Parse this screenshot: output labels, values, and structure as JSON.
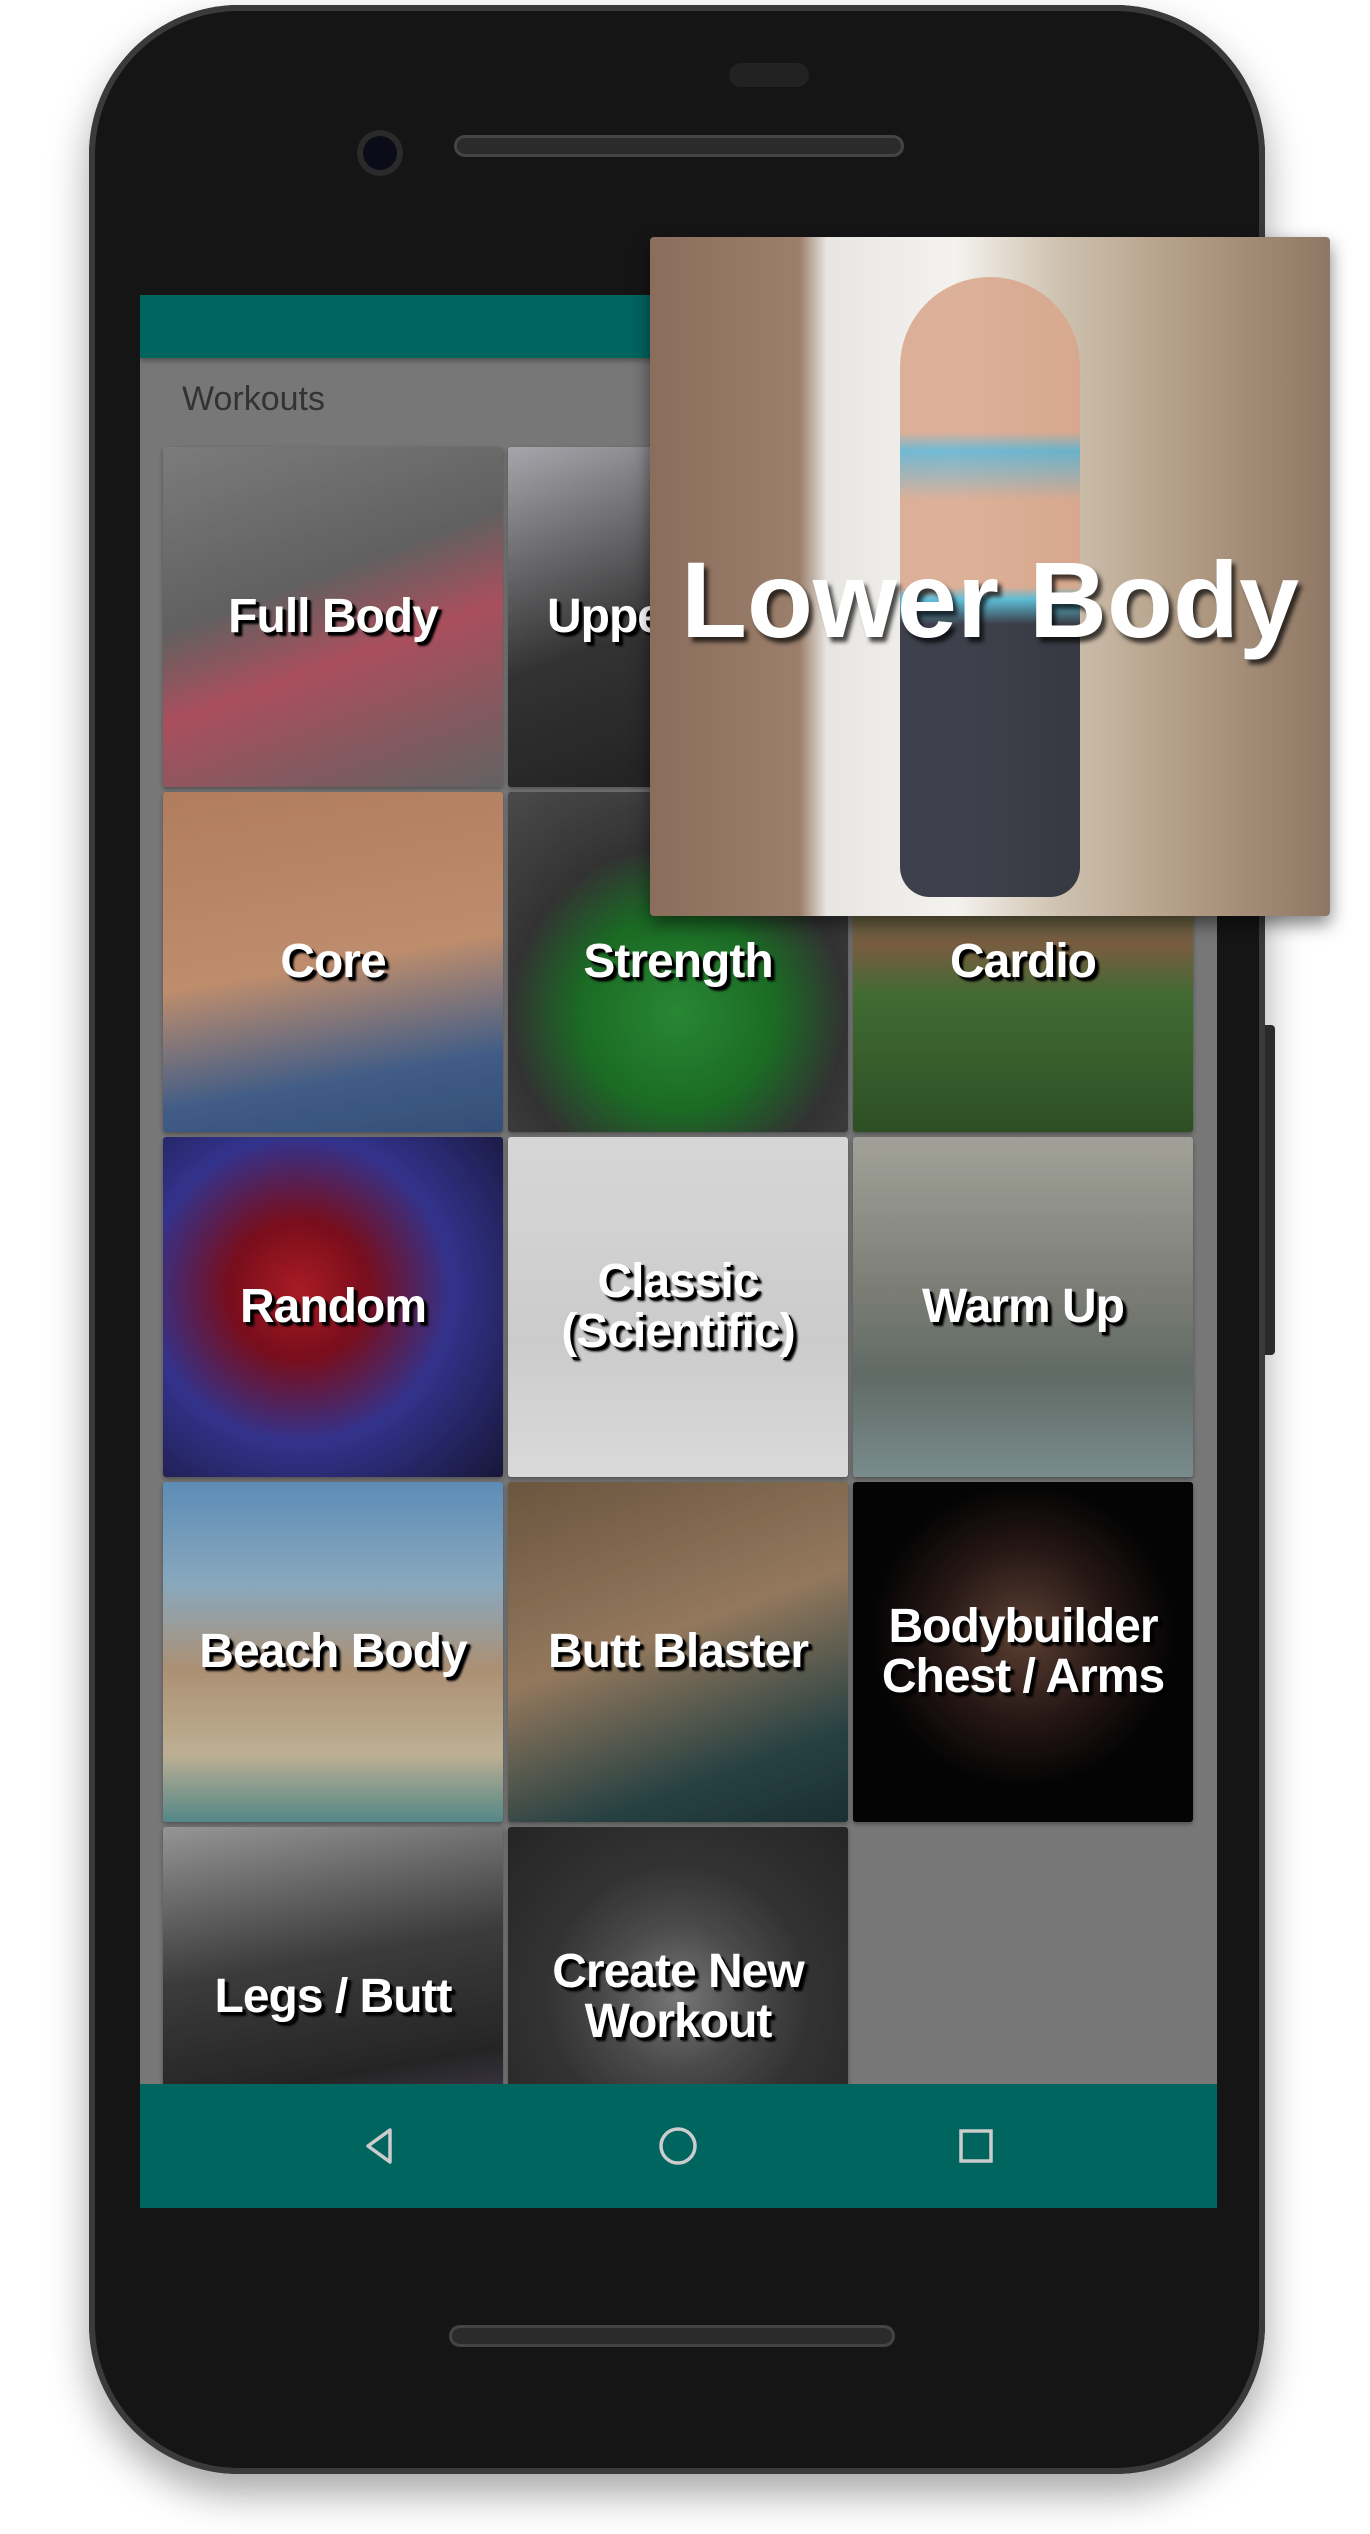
{
  "app": {
    "screen_title": "Workouts",
    "accent_color": "#00645f"
  },
  "tiles": [
    {
      "label": "Full Body",
      "bg": "linear-gradient(160deg,#8d8d8d,#6e6e6e 40%,#c25a6a 60%,#707070)"
    },
    {
      "label": "Upper Body",
      "bg": "linear-gradient(160deg,#bdbdc4,#3a3a3a 50%,#202020)"
    },
    {
      "label": "",
      "bg": "#777"
    },
    {
      "label": "Core",
      "bg": "linear-gradient(170deg,#c98e6b,#d9a17c 50%,#4a6a9a 80%,#3b5a88)"
    },
    {
      "label": "Strength",
      "bg": "radial-gradient(circle at 50% 65%,#2f9a3c 0,#1f7a2a 35%,#3a3a3a 60%,#555)"
    },
    {
      "label": "Cardio",
      "bg": "linear-gradient(180deg,#3a4a3a,#6d7a50 30%,#8a6a4a 45%,#4a7a3a 60%,#355a2a)"
    },
    {
      "label": "Random",
      "bg": "radial-gradient(circle at 40% 45%,#c0202a 0,#8a1020 25%,#3a3aa0 55%,#1a1a40)"
    },
    {
      "label": "Classic (Scientific)",
      "bg": "linear-gradient(180deg,#f4f4f4,#e8e8e8 60%,#f8f8f8)"
    },
    {
      "label": "Warm Up",
      "bg": "linear-gradient(180deg,#b8b8ae,#8d8f86 45%,#6e7a74 70%,#8aa0a0)"
    },
    {
      "label": "Beach Body",
      "bg": "linear-gradient(180deg,#6aa0d0,#9cc0d8 30%,#c4a484 55%,#d8c8a8 80%,#5f9a9a)"
    },
    {
      "label": "Butt Blaster",
      "bg": "linear-gradient(160deg,#7a6248,#a8896a 45%,#2c4a4c 80%,#1e3638)"
    },
    {
      "label": "Bodybuilder Chest / Arms",
      "bg": "radial-gradient(circle at 50% 45%,#6a4a3a 0,#2a1a18 35%,#050505 60%)"
    },
    {
      "label": "Legs / Butt",
      "bg": "linear-gradient(170deg,#aaa,#444 40%,#2a2a2a 70%,#6a5a8a)"
    },
    {
      "label": "Create New Workout",
      "bg": "radial-gradient(circle at 50% 50%,#888 0,#555 30%,#3a3a3a 55%,#2a2a2a)"
    }
  ],
  "overlay": {
    "label": "Lower Body"
  },
  "navbar": {
    "back": "back-icon",
    "home": "home-icon",
    "recents": "recents-icon"
  }
}
